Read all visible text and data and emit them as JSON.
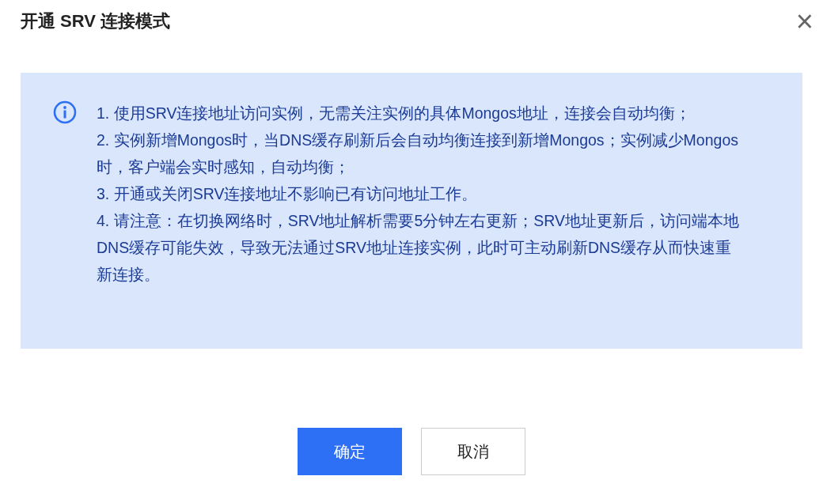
{
  "dialog": {
    "title": "开通 SRV 连接模式",
    "close": "×"
  },
  "notice": {
    "items": [
      "1. 使用SRV连接地址访问实例，无需关注实例的具体Mongos地址，连接会自动均衡；",
      "2. 实例新增Mongos时，当DNS缓存刷新后会自动均衡连接到新增Mongos；实例减少Mongos时，客户端会实时感知，自动均衡；",
      "3. 开通或关闭SRV连接地址不影响已有访问地址工作。",
      "4. 请注意：在切换网络时，SRV地址解析需要5分钟左右更新；SRV地址更新后，访问端本地DNS缓存可能失效，导致无法通过SRV地址连接实例，此时可主动刷新DNS缓存从而快速重新连接。"
    ]
  },
  "buttons": [
    {
      "label": "确定",
      "kind": "primary"
    },
    {
      "label": "取消",
      "kind": "secondary"
    }
  ]
}
